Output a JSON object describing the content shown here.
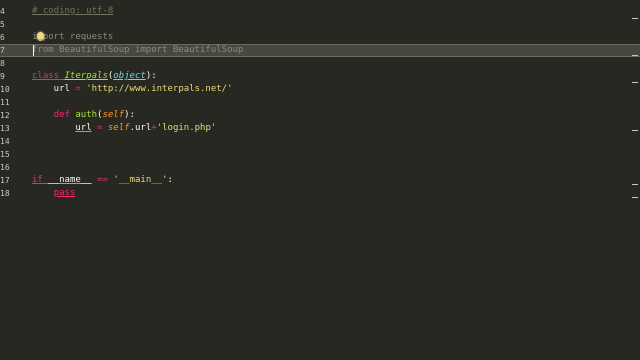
{
  "editor": {
    "lines": [
      {
        "num": "4",
        "segments": [
          {
            "t": "# coding: utf-8",
            "c": "tok-comment"
          }
        ]
      },
      {
        "num": "5",
        "segments": []
      },
      {
        "num": "6",
        "segments": [
          {
            "t": "import requests",
            "c": "tok-faded"
          }
        ]
      },
      {
        "num": "7",
        "segments": [
          {
            "t": "from BeautifulSoup import BeautifulSoup",
            "c": "tok-faded"
          }
        ]
      },
      {
        "num": "8",
        "segments": []
      },
      {
        "num": "9",
        "segments": [
          {
            "t": "class ",
            "c": "tok-kw-u"
          },
          {
            "t": "Iterpals",
            "c": "tok-cls"
          },
          {
            "t": "(",
            "c": "tok-paren"
          },
          {
            "t": "object",
            "c": "tok-builtin"
          },
          {
            "t": "):",
            "c": "tok-paren"
          }
        ]
      },
      {
        "num": "10",
        "segments": [
          {
            "t": "    url ",
            "c": "tok-plain"
          },
          {
            "t": "= ",
            "c": "tok-op"
          },
          {
            "t": "'http://www.interpals.net/'",
            "c": "tok-str"
          }
        ]
      },
      {
        "num": "11",
        "segments": []
      },
      {
        "num": "12",
        "segments": [
          {
            "t": "    def ",
            "c": "tok-kw"
          },
          {
            "t": "auth",
            "c": "tok-fn"
          },
          {
            "t": "(",
            "c": "tok-paren"
          },
          {
            "t": "self",
            "c": "tok-self"
          },
          {
            "t": "):",
            "c": "tok-paren"
          }
        ]
      },
      {
        "num": "13",
        "segments": [
          {
            "t": "        ",
            "c": "tok-plain"
          },
          {
            "t": "url",
            "c": "tok-plain-u"
          },
          {
            "t": " = ",
            "c": "tok-op"
          },
          {
            "t": "self",
            "c": "tok-self"
          },
          {
            "t": ".url",
            "c": "tok-plain"
          },
          {
            "t": "+",
            "c": "tok-op"
          },
          {
            "t": "'login.php'",
            "c": "tok-str"
          }
        ]
      },
      {
        "num": "14",
        "segments": []
      },
      {
        "num": "15",
        "segments": []
      },
      {
        "num": "16",
        "segments": []
      },
      {
        "num": "17",
        "segments": [
          {
            "t": "if ",
            "c": "tok-kw-u"
          },
          {
            "t": "__name__",
            "c": "tok-plain-u"
          },
          {
            "t": " == ",
            "c": "tok-op"
          },
          {
            "t": "'__main__'",
            "c": "tok-str"
          },
          {
            "t": ":",
            "c": "tok-paren"
          }
        ]
      },
      {
        "num": "18",
        "segments": [
          {
            "t": "    ",
            "c": "tok-plain"
          },
          {
            "t": "pass",
            "c": "tok-kw-u"
          }
        ]
      }
    ],
    "highlighted_line": "7",
    "colors": {
      "background": "#272822",
      "highlight": "#49483e",
      "keyword": "#f92672",
      "string": "#e6db74",
      "function": "#a6e22e",
      "comment": "#75715e"
    }
  }
}
